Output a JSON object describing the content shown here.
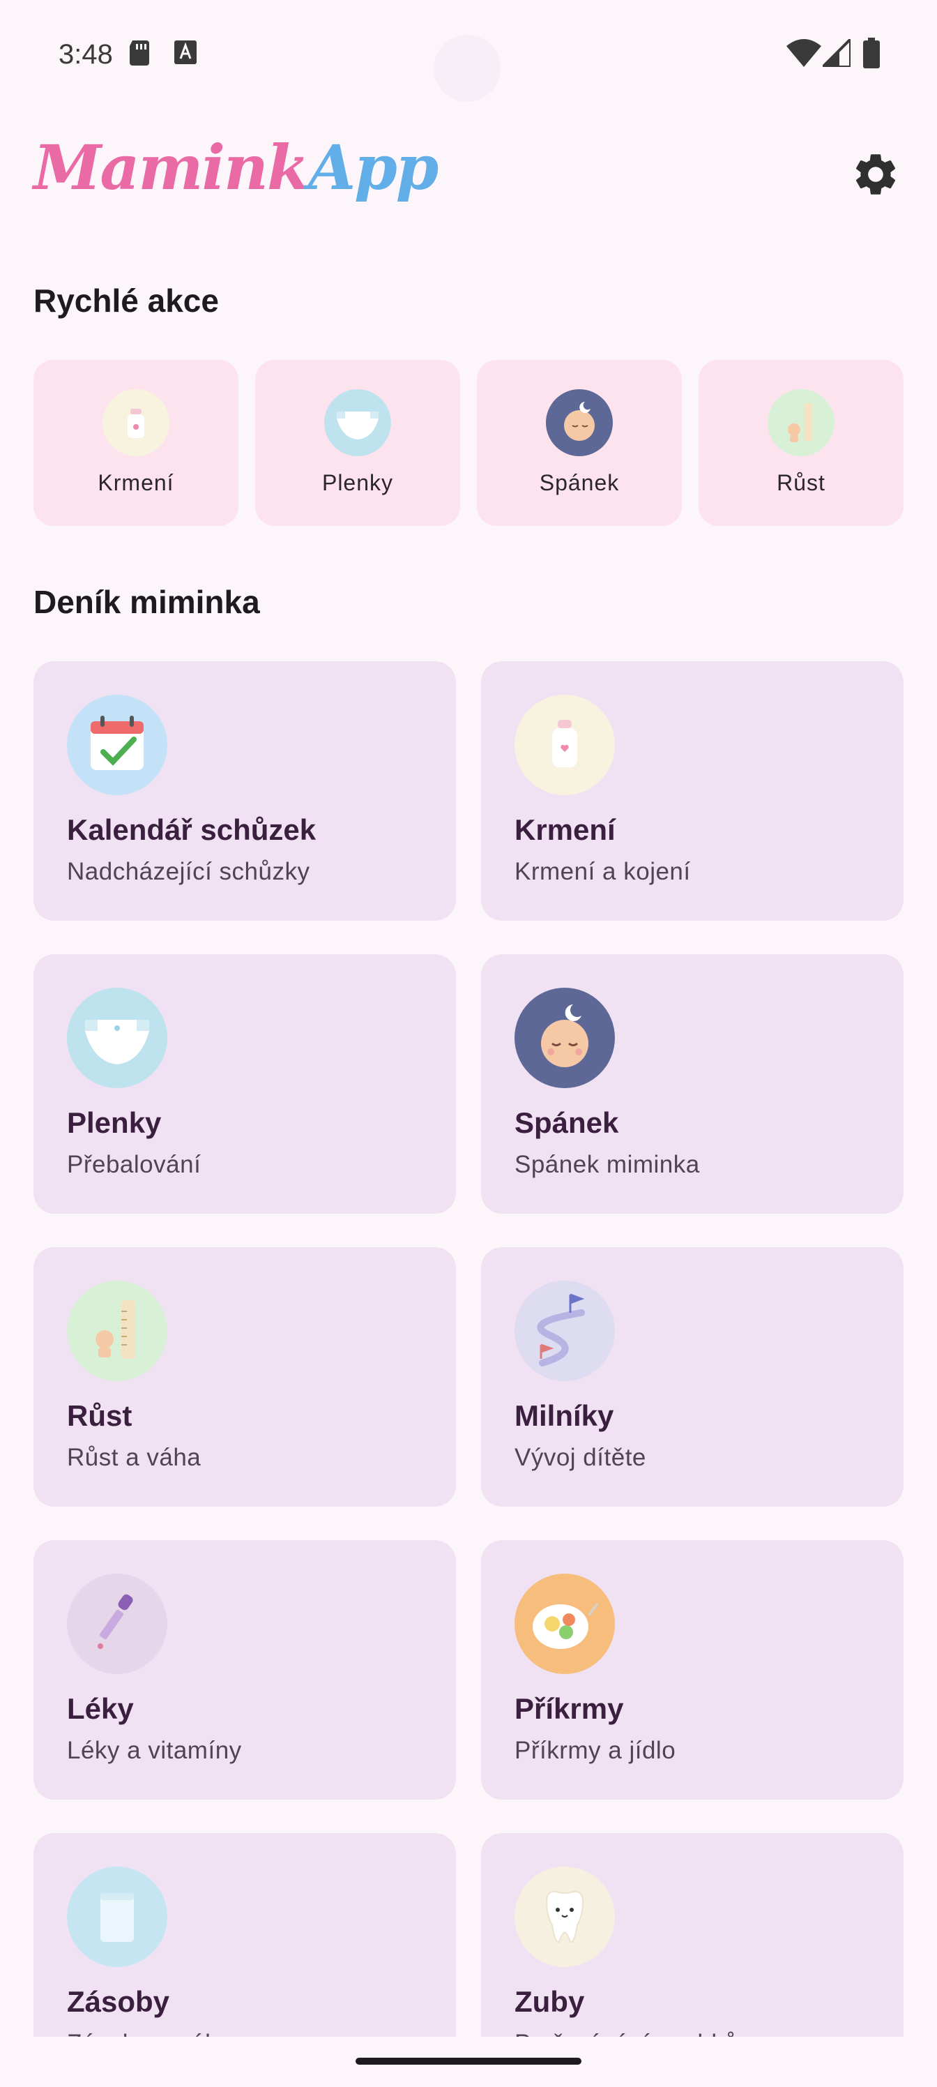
{
  "status_bar": {
    "time": "3:48"
  },
  "header": {
    "logo_part1": "Mamink",
    "logo_part2": "App"
  },
  "quick_actions": {
    "title": "Rychlé akce",
    "items": [
      {
        "label": "Krmení",
        "icon": "bottle-icon",
        "icon_bg": "#f7f3df"
      },
      {
        "label": "Plenky",
        "icon": "diaper-icon",
        "icon_bg": "#bfe3ee"
      },
      {
        "label": "Spánek",
        "icon": "sleeping-baby-icon",
        "icon_bg": "#5d6897"
      },
      {
        "label": "Růst",
        "icon": "growth-ruler-icon",
        "icon_bg": "#d8f0d6"
      }
    ]
  },
  "diary": {
    "title": "Deník miminka",
    "cards": [
      {
        "title": "Kalendář schůzek",
        "subtitle": "Nadcházející schůzky",
        "icon": "calendar-icon",
        "icon_bg": "#c4e2f7"
      },
      {
        "title": "Krmení",
        "subtitle": "Krmení a kojení",
        "icon": "bottle-icon",
        "icon_bg": "#f7f3df"
      },
      {
        "title": "Plenky",
        "subtitle": "Přebalování",
        "icon": "diaper-icon",
        "icon_bg": "#bfe3ee"
      },
      {
        "title": "Spánek",
        "subtitle": "Spánek miminka",
        "icon": "sleeping-baby-icon",
        "icon_bg": "#5d6897"
      },
      {
        "title": "Růst",
        "subtitle": "Růst a váha",
        "icon": "growth-ruler-icon",
        "icon_bg": "#d8f0d6"
      },
      {
        "title": "Milníky",
        "subtitle": "Vývoj dítěte",
        "icon": "milestone-flags-icon",
        "icon_bg": "#dedcf0"
      },
      {
        "title": "Léky",
        "subtitle": "Léky a vitamíny",
        "icon": "dropper-icon",
        "icon_bg": "#e5d6ea"
      },
      {
        "title": "Příkrmy",
        "subtitle": "Příkrmy a jídlo",
        "icon": "food-plate-icon",
        "icon_bg": "#f6bd7c"
      },
      {
        "title": "Zásoby",
        "subtitle": "Zásoby a nákupy",
        "icon": "supplies-bag-icon",
        "icon_bg": "#c5e5f2"
      },
      {
        "title": "Zuby",
        "subtitle": "Prořezávání zoubků",
        "icon": "tooth-icon",
        "icon_bg": "#f5f0df"
      }
    ]
  }
}
